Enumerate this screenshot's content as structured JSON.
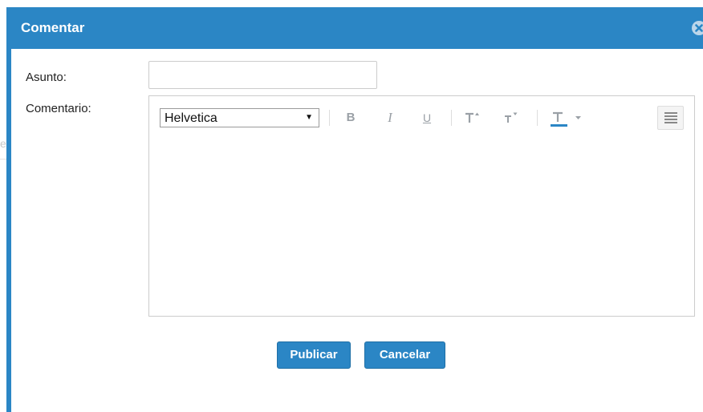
{
  "background": {
    "partial_letter": "e"
  },
  "dialog": {
    "title": "Comentar",
    "close_icon": "close-circle-icon",
    "accent_color": "#2b86c5"
  },
  "form": {
    "subject_label": "Asunto:",
    "subject_value": "",
    "subject_placeholder": "",
    "comment_label": "Comentario:"
  },
  "editor": {
    "font_family_selected": "Helvetica",
    "toolbar": {
      "bold": "B",
      "italic": "I",
      "underline": "U",
      "size_up_icon": "text-size-up-icon",
      "size_down_icon": "text-size-down-icon",
      "text_color_icon": "text-color-icon",
      "text_color": "#2b86c5",
      "list_icon": "list-menu-icon"
    },
    "content": ""
  },
  "actions": {
    "publish_label": "Publicar",
    "cancel_label": "Cancelar"
  }
}
